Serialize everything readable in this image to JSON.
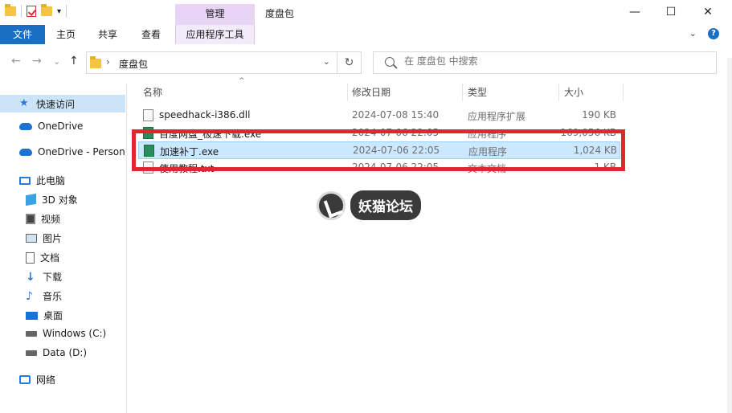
{
  "window": {
    "title": "度盘包",
    "context_tab": "管理",
    "controls": {
      "minimize": "—",
      "maximize": "☐",
      "close": "✕"
    }
  },
  "ribbon": {
    "tabs": [
      "文件",
      "主页",
      "共享",
      "查看",
      "应用程序工具"
    ],
    "collapse_icon": "⌄",
    "help": "?"
  },
  "nav": {
    "back": "←",
    "forward": "→",
    "recent": "⌄",
    "up": "↑",
    "path_sep": "›",
    "path": "度盘包",
    "refresh": "↻",
    "search_placeholder": "在 度盘包 中搜索"
  },
  "sidebar": {
    "items": [
      {
        "label": "快速访问",
        "icon": "star-icon"
      },
      {
        "label": "OneDrive",
        "icon": "cloud-icon"
      },
      {
        "label": "OneDrive - Personal",
        "icon": "cloud-icon"
      },
      {
        "label": "此电脑",
        "icon": "computer-icon"
      },
      {
        "label": "3D 对象",
        "icon": "cube-icon"
      },
      {
        "label": "视频",
        "icon": "video-icon"
      },
      {
        "label": "图片",
        "icon": "picture-icon"
      },
      {
        "label": "文档",
        "icon": "document-icon"
      },
      {
        "label": "下载",
        "icon": "download-icon"
      },
      {
        "label": "音乐",
        "icon": "music-icon"
      },
      {
        "label": "桌面",
        "icon": "desktop-icon"
      },
      {
        "label": "Windows (C:)",
        "icon": "drive-icon"
      },
      {
        "label": "Data (D:)",
        "icon": "drive-icon"
      },
      {
        "label": "网络",
        "icon": "network-icon"
      }
    ]
  },
  "columns": {
    "name": "名称",
    "date": "修改日期",
    "type": "类型",
    "size": "大小"
  },
  "files": [
    {
      "name": "speedhack-i386.dll",
      "date": "2024-07-08 15:40",
      "type": "应用程序扩展",
      "size": "190 KB"
    },
    {
      "name": "百度网盘_极速下载.exe",
      "date": "2024-07-06 22:05",
      "type": "应用程序",
      "size": "169,056 KB"
    },
    {
      "name": "加速补丁.exe",
      "date": "2024-07-06 22:05",
      "type": "应用程序",
      "size": "1,024 KB"
    },
    {
      "name": "使用教程.txt",
      "date": "2024-07-06 22:05",
      "type": "文本文档",
      "size": "1 KB"
    }
  ],
  "selected_file_index": 2,
  "highlight_color": "#e0262e",
  "accent_color": "#1a6fc2",
  "watermark": "妖猫论坛"
}
